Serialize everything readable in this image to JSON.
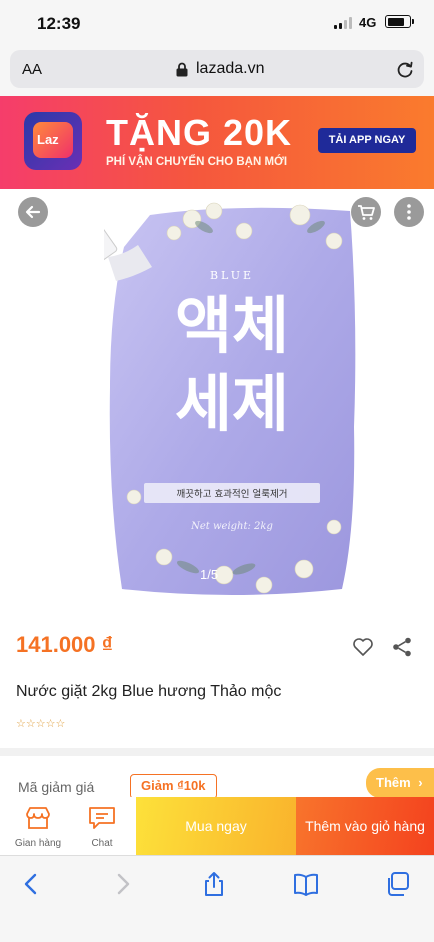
{
  "status_bar": {
    "time": "12:39",
    "network": "4G",
    "battery_level": 0.8
  },
  "browser": {
    "text_size": "AA",
    "url": "lazada.vn"
  },
  "banner": {
    "logo_text": "Laz",
    "headline": "TẶNG 20K",
    "subtitle": "PHÍ VẬN CHUYỂN CHO BẠN MỚI",
    "cta": "TẢI APP NGAY"
  },
  "gallery": {
    "counter": "1/5",
    "product_image_text": {
      "brand": "BLUE",
      "line1": "액체",
      "line2": "세제",
      "tagline": "깨끗하고 효과적인 얼룩제거",
      "weight": "Net weight: 2kg"
    }
  },
  "product": {
    "price": "141.000 ₫",
    "title": "Nước giặt 2kg Blue hương Thảo mộc",
    "rating_stars": "☆☆☆☆☆"
  },
  "voucher": {
    "label": "Mã giảm giá",
    "chip": "Giảm ₫10k",
    "more": "Thêm"
  },
  "actions": {
    "shop": "Gian hàng",
    "chat": "Chat",
    "buy_now": "Mua ngay",
    "add_to_cart": "Thêm vào giỏ hàng"
  },
  "colors": {
    "accent": "#f57224",
    "banner_button": "#1f2a99",
    "buy_now": "#f9b32c",
    "add_to_cart": "#f4421e",
    "pouch": "#b7b4ec"
  }
}
